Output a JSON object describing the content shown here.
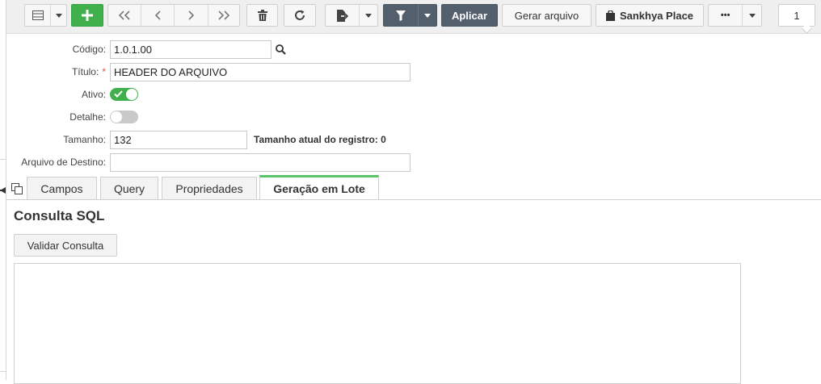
{
  "toolbar": {
    "apply_label": "Aplicar",
    "generate_label": "Gerar arquivo",
    "place_label": "Sankhya Place",
    "more_label": "•••",
    "page_number": "1"
  },
  "form": {
    "codigo_label": "Código:",
    "codigo_value": "1.0.1.00",
    "titulo_label": "Título:",
    "titulo_required": "*",
    "titulo_value": "HEADER DO ARQUIVO",
    "ativo_label": "Ativo:",
    "ativo_on": true,
    "detalhe_label": "Detalhe:",
    "detalhe_on": false,
    "tamanho_label": "Tamanho:",
    "tamanho_value": "132",
    "tamanho_atual": "Tamanho atual do registro: 0",
    "destino_label": "Arquivo de Destino:",
    "destino_value": ""
  },
  "tabs": [
    {
      "label": "Campos"
    },
    {
      "label": "Query"
    },
    {
      "label": "Propriedades"
    },
    {
      "label": "Geração em Lote"
    }
  ],
  "active_tab": 3,
  "panel": {
    "title": "Consulta SQL",
    "validate_label": "Validar Consulta"
  },
  "colors": {
    "accent_green": "#3fb04b",
    "dark_button": "#535f6d",
    "active_tab_border": "#5cc26a",
    "required": "#d9534f"
  }
}
